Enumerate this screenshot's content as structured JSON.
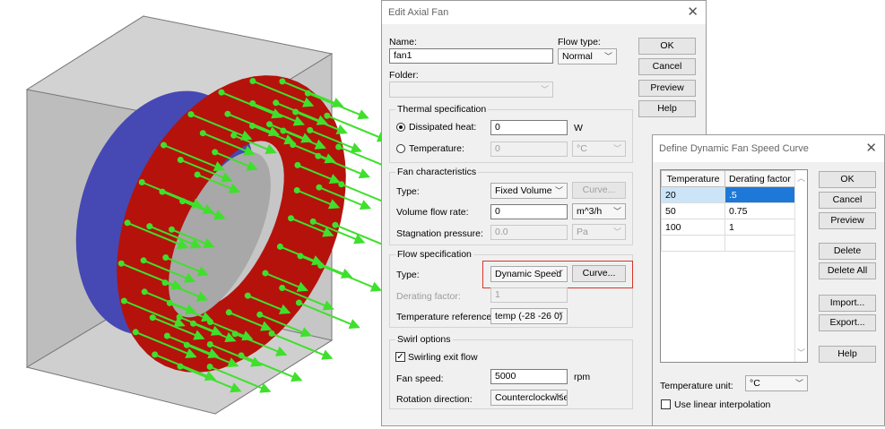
{
  "colors": {
    "blade": "#b5120c",
    "ring": "#4649b3",
    "arrow": "#3fe02c",
    "highlight": "#d9342b"
  },
  "axial_fan": {
    "title": "Edit Axial Fan",
    "close_glyph": "✕",
    "name_label": "Name:",
    "name_value": "fan1",
    "flow_type_label": "Flow type:",
    "flow_type_value": "Normal",
    "folder_label": "Folder:",
    "folder_value": "",
    "buttons": {
      "ok": "OK",
      "cancel": "Cancel",
      "preview": "Preview",
      "help": "Help"
    },
    "thermal": {
      "title": "Thermal specification",
      "dissipated_label": "Dissipated heat:",
      "dissipated_value": "0",
      "dissipated_unit": "W",
      "temperature_label": "Temperature:",
      "temperature_value": "0",
      "temperature_unit": "°C"
    },
    "fan_char": {
      "title": "Fan characteristics",
      "type_label": "Type:",
      "type_value": "Fixed Volume",
      "curve_button": "Curve...",
      "volume_label": "Volume flow rate:",
      "volume_value": "0",
      "volume_unit": "m^3/h",
      "stagnation_label": "Stagnation pressure:",
      "stagnation_value": "0.0",
      "stagnation_unit": "Pa"
    },
    "flow_spec": {
      "title": "Flow specification",
      "type_label": "Type:",
      "type_value": "Dynamic Speed",
      "curve_button": "Curve...",
      "derating_label": "Derating factor:",
      "derating_value": "1",
      "tempref_label": "Temperature reference:",
      "tempref_value": "temp (-28 -26 0)"
    },
    "swirl": {
      "title": "Swirl options",
      "swirling_label": "Swirling exit flow",
      "swirling_checked": true,
      "speed_label": "Fan speed:",
      "speed_value": "5000",
      "speed_unit": "rpm",
      "rotation_label": "Rotation direction:",
      "rotation_value": "Counterclockwise"
    }
  },
  "speed_curve": {
    "title": "Define Dynamic Fan Speed Curve",
    "close_glyph": "✕",
    "columns": [
      "Temperature",
      "Derating factor"
    ],
    "rows": [
      [
        "20",
        ".5"
      ],
      [
        "50",
        "0.75"
      ],
      [
        "100",
        "1"
      ],
      [
        "",
        ""
      ]
    ],
    "buttons": {
      "ok": "OK",
      "cancel": "Cancel",
      "preview": "Preview",
      "delete": "Delete",
      "delete_all": "Delete All",
      "import": "Import...",
      "export": "Export...",
      "help": "Help"
    },
    "unit_label": "Temperature unit:",
    "unit_value": "°C",
    "linear_label": "Use linear interpolation",
    "linear_checked": false
  }
}
